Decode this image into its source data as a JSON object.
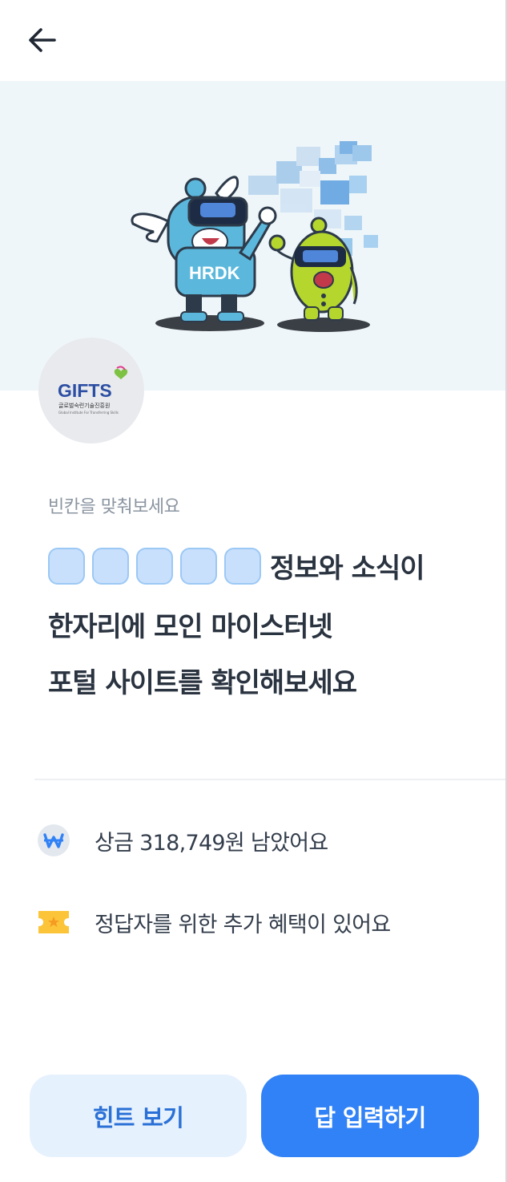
{
  "header": {
    "back_icon": "arrow-left-icon"
  },
  "hero": {
    "illustration": "hrdk-mascots-vr-illustration",
    "mascot_text": "HRDK"
  },
  "logo": {
    "text": "GIFTS",
    "subtitle": "글로벌숙련기술진흥원",
    "subtitle_en": "Global Institute For Transferring Skills"
  },
  "quiz": {
    "instruction": "빈칸을 맞춰보세요",
    "blank_count": 5,
    "line1_suffix": "정보와 소식이",
    "line2": "한자리에 모인 마이스터넷",
    "line3": "포털 사이트를 확인해보세요"
  },
  "info": {
    "prize_icon": "won-coin-icon",
    "prize_text": "상금 318,749원 남았어요",
    "benefit_icon": "ticket-star-icon",
    "benefit_text": "정답자를 위한 추가 혜택이 있어요"
  },
  "buttons": {
    "hint_label": "힌트 보기",
    "answer_label": "답 입력하기"
  },
  "colors": {
    "primary": "#3182f6",
    "hint_bg": "#e6f1fe",
    "blank_fill": "#c8e0fb",
    "hero_bg": "#eff6f9"
  }
}
